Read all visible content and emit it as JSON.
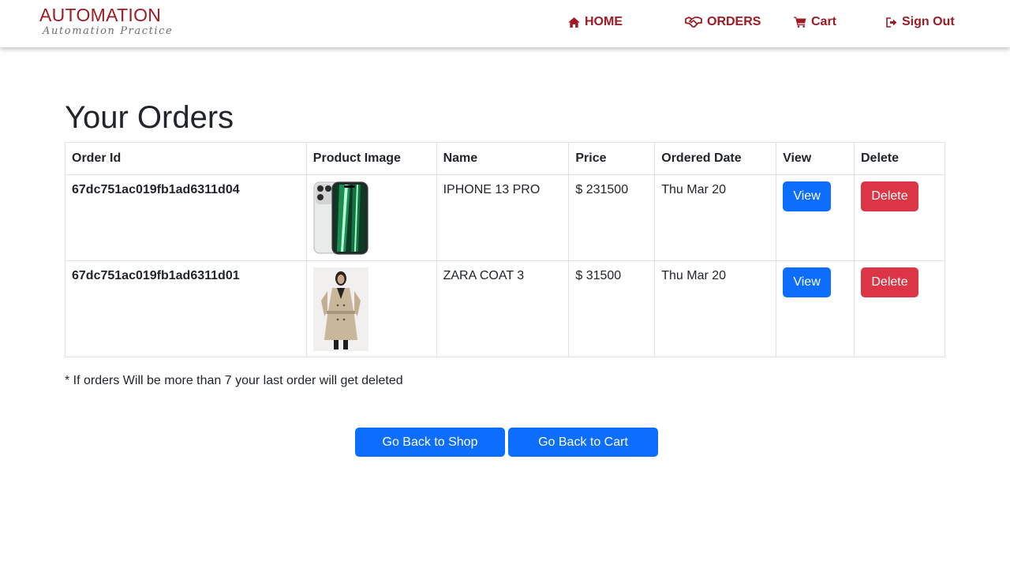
{
  "brand": {
    "title": "AUTOMATION",
    "subtitle": "Automation Practice"
  },
  "nav": {
    "home": "HOME",
    "orders": "ORDERS",
    "cart": "Cart",
    "signout": "Sign Out"
  },
  "page": {
    "title": "Your Orders"
  },
  "table": {
    "headers": [
      "Order Id",
      "Product Image",
      "Name",
      "Price",
      "Ordered Date",
      "View",
      "Delete"
    ],
    "rows": [
      {
        "order_id": "67dc751ac019fb1ad6311d04",
        "image": "iphone-product-image",
        "name": "IPHONE 13 PRO",
        "price": "$ 231500",
        "date": "Thu Mar 20",
        "view_label": "View",
        "delete_label": "Delete"
      },
      {
        "order_id": "67dc751ac019fb1ad6311d01",
        "image": "coat-product-image",
        "name": "ZARA COAT 3",
        "price": "$ 31500",
        "date": "Thu Mar 20",
        "view_label": "View",
        "delete_label": "Delete"
      }
    ]
  },
  "note": "* If orders Will be more than 7 your last order will get deleted",
  "actions": {
    "shop": "Go Back to Shop",
    "cart": "Go Back to Cart"
  },
  "colors": {
    "brand": "#9e1b23",
    "primary": "#0d6efd",
    "danger": "#dc3545"
  }
}
